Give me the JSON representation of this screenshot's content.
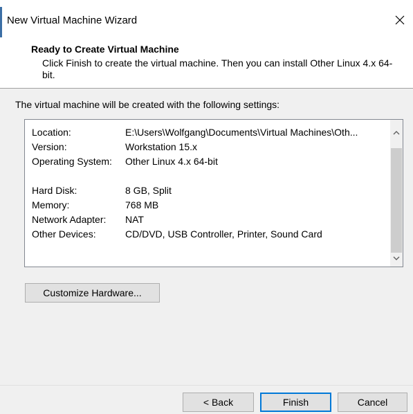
{
  "window": {
    "title": "New Virtual Machine Wizard"
  },
  "header": {
    "title": "Ready to Create Virtual Machine",
    "subtitle": "Click Finish to create the virtual machine. Then you can install Other Linux 4.x 64-bit."
  },
  "intro_text": "The virtual machine will be created with the following settings:",
  "settings": {
    "location_label": "Location:",
    "location_value": "E:\\Users\\Wolfgang\\Documents\\Virtual Machines\\Oth...",
    "version_label": "Version:",
    "version_value": "Workstation 15.x",
    "os_label": "Operating System:",
    "os_value": "Other Linux 4.x 64-bit",
    "hard_disk_label": "Hard Disk:",
    "hard_disk_value": "8 GB, Split",
    "memory_label": "Memory:",
    "memory_value": "768 MB",
    "network_label": "Network Adapter:",
    "network_value": "NAT",
    "other_devices_label": "Other Devices:",
    "other_devices_value": "CD/DVD, USB Controller, Printer, Sound Card"
  },
  "buttons": {
    "customize": "Customize Hardware...",
    "back": "< Back",
    "finish": "Finish",
    "cancel": "Cancel"
  },
  "icons": {
    "close": "close-icon",
    "scroll_up": "chevron-up-icon",
    "scroll_down": "chevron-down-icon"
  },
  "colors": {
    "accent": "#0078d7",
    "window_edge": "#3b6ea5"
  }
}
